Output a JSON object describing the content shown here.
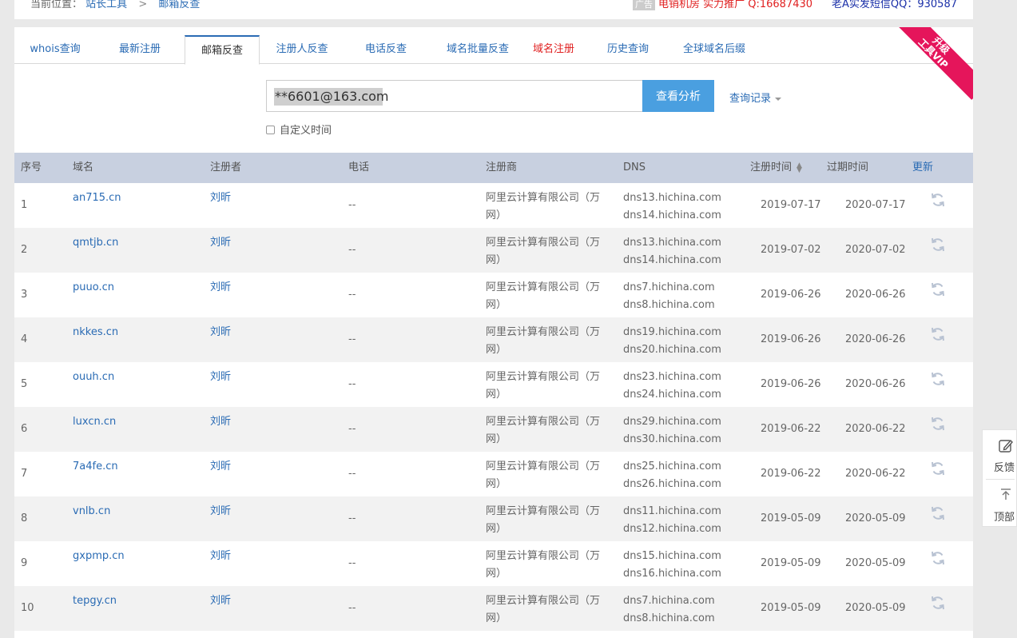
{
  "breadcrumb": {
    "label": "当前位置：",
    "home": "站长工具",
    "sep": ">",
    "current": "邮箱反查"
  },
  "ad": {
    "tag": "广告",
    "text1": "电销机房 实力推广 Q:16687430",
    "text2": "老A实发短信QQ：930587"
  },
  "tabs": [
    {
      "label": "whois查询"
    },
    {
      "label": "最新注册"
    },
    {
      "label": "邮箱反查"
    },
    {
      "label": "注册人反查"
    },
    {
      "label": "电话反查"
    },
    {
      "label": "域名批量反查"
    },
    {
      "label": "域名注册"
    },
    {
      "label": "历史查询"
    },
    {
      "label": "全球域名后缀"
    }
  ],
  "vip": {
    "line1": "升级",
    "line2": "工具VIP"
  },
  "search": {
    "value": "**6601@163.com",
    "button": "查看分析",
    "history": "查询记录",
    "custom_time": "自定义时间"
  },
  "table": {
    "headers": {
      "index": "序号",
      "domain": "域名",
      "registrant": "注册者",
      "phone": "电话",
      "registrar": "注册商",
      "dns": "DNS",
      "reg_time": "注册时间",
      "exp_time": "过期时间",
      "update": "更新"
    },
    "rows": [
      {
        "index": "1",
        "domain": "an715.cn",
        "registrant": "刘昕",
        "phone": "--",
        "registrar1": "阿里云计算有限公司（万",
        "registrar2": "网）",
        "dns1": "dns13.hichina.com",
        "dns2": "dns14.hichina.com",
        "reg": "2019-07-17",
        "exp": "2020-07-17"
      },
      {
        "index": "2",
        "domain": "qmtjb.cn",
        "registrant": "刘昕",
        "phone": "--",
        "registrar1": "阿里云计算有限公司（万",
        "registrar2": "网）",
        "dns1": "dns13.hichina.com",
        "dns2": "dns14.hichina.com",
        "reg": "2019-07-02",
        "exp": "2020-07-02"
      },
      {
        "index": "3",
        "domain": "puuo.cn",
        "registrant": "刘昕",
        "phone": "--",
        "registrar1": "阿里云计算有限公司（万",
        "registrar2": "网）",
        "dns1": "dns7.hichina.com",
        "dns2": "dns8.hichina.com",
        "reg": "2019-06-26",
        "exp": "2020-06-26"
      },
      {
        "index": "4",
        "domain": "nkkes.cn",
        "registrant": "刘昕",
        "phone": "--",
        "registrar1": "阿里云计算有限公司（万",
        "registrar2": "网）",
        "dns1": "dns19.hichina.com",
        "dns2": "dns20.hichina.com",
        "reg": "2019-06-26",
        "exp": "2020-06-26"
      },
      {
        "index": "5",
        "domain": "ouuh.cn",
        "registrant": "刘昕",
        "phone": "--",
        "registrar1": "阿里云计算有限公司（万",
        "registrar2": "网）",
        "dns1": "dns23.hichina.com",
        "dns2": "dns24.hichina.com",
        "reg": "2019-06-26",
        "exp": "2020-06-26"
      },
      {
        "index": "6",
        "domain": "luxcn.cn",
        "registrant": "刘昕",
        "phone": "--",
        "registrar1": "阿里云计算有限公司（万",
        "registrar2": "网）",
        "dns1": "dns29.hichina.com",
        "dns2": "dns30.hichina.com",
        "reg": "2019-06-22",
        "exp": "2020-06-22"
      },
      {
        "index": "7",
        "domain": "7a4fe.cn",
        "registrant": "刘昕",
        "phone": "--",
        "registrar1": "阿里云计算有限公司（万",
        "registrar2": "网）",
        "dns1": "dns25.hichina.com",
        "dns2": "dns26.hichina.com",
        "reg": "2019-06-22",
        "exp": "2020-06-22"
      },
      {
        "index": "8",
        "domain": "vnlb.cn",
        "registrant": "刘昕",
        "phone": "--",
        "registrar1": "阿里云计算有限公司（万",
        "registrar2": "网）",
        "dns1": "dns11.hichina.com",
        "dns2": "dns12.hichina.com",
        "reg": "2019-05-09",
        "exp": "2020-05-09"
      },
      {
        "index": "9",
        "domain": "gxpmp.cn",
        "registrant": "刘昕",
        "phone": "--",
        "registrar1": "阿里云计算有限公司（万",
        "registrar2": "网）",
        "dns1": "dns15.hichina.com",
        "dns2": "dns16.hichina.com",
        "reg": "2019-05-09",
        "exp": "2020-05-09"
      },
      {
        "index": "10",
        "domain": "tepgy.cn",
        "registrant": "刘昕",
        "phone": "--",
        "registrar1": "阿里云计算有限公司（万",
        "registrar2": "网）",
        "dns1": "dns7.hichina.com",
        "dns2": "dns8.hichina.com",
        "reg": "2019-05-09",
        "exp": "2020-05-09"
      }
    ]
  },
  "float": {
    "feedback": "反馈",
    "top": "顶部"
  },
  "colors": {
    "accent": "#2a6bb4",
    "button": "#4a9fe0",
    "vip": "#e5155b",
    "header_bg": "#c8d0e0"
  },
  "icons": [
    "refresh-icon",
    "edit-icon",
    "arrow-up-icon",
    "checkbox-icon",
    "caret-down-icon",
    "sort-icon"
  ]
}
